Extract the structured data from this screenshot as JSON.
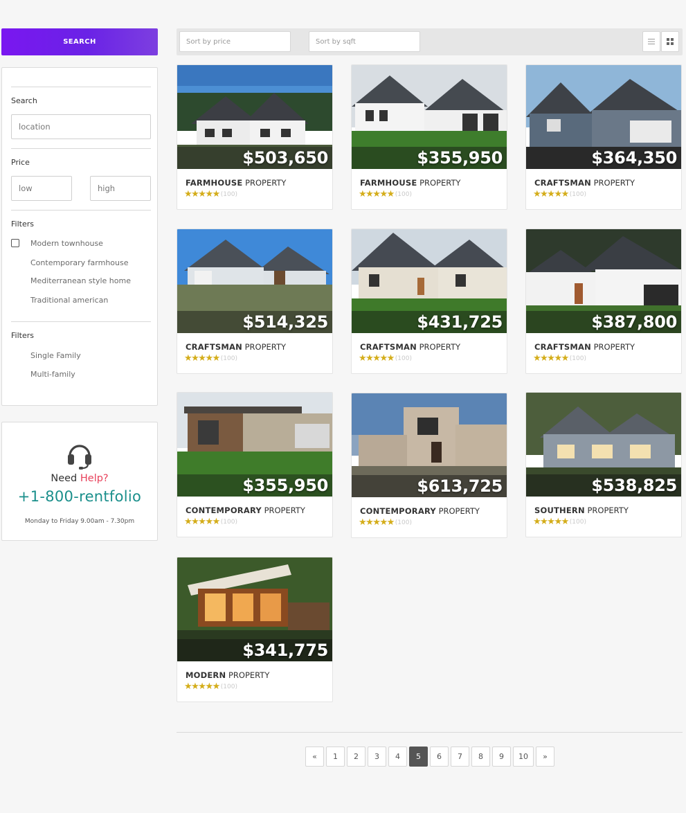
{
  "sidebar": {
    "search_button": "SEARCH",
    "search_label": "Search",
    "location_placeholder": "location",
    "price_label": "Price",
    "low_placeholder": "low",
    "high_placeholder": "high",
    "filters1_label": "Filters",
    "style_options": [
      "Modern townhouse",
      "Contemporary farmhouse",
      "Mediterranean style home",
      "Traditional american"
    ],
    "filters2_label": "Filters",
    "family_options": [
      "Single Family",
      "Multi-family"
    ]
  },
  "help": {
    "icon": "headset-icon",
    "need": "Need",
    "help_word": "Help?",
    "phone": "+1-800-rentfolio",
    "hours": "Monday to Friday 9.00am - 7.30pm"
  },
  "toolbar": {
    "sort_price_placeholder": "Sort by price",
    "sort_sqft_placeholder": "Sort by sqft",
    "list_view_icon": "list-view-icon",
    "grid_view_icon": "grid-view-icon"
  },
  "listings": [
    {
      "price": "$503,650",
      "style": "FARMHOUSE",
      "suffix": "PROPERTY",
      "stars": "★★★★★",
      "reviews": "(100)",
      "rating": 5
    },
    {
      "price": "$355,950",
      "style": "FARMHOUSE",
      "suffix": "PROPERTY",
      "stars": "★★★★★",
      "reviews": "(100)",
      "rating": 5
    },
    {
      "price": "$364,350",
      "style": "CRAFTSMAN",
      "suffix": "PROPERTY",
      "stars": "★★★★★",
      "reviews": "(100)",
      "rating": 5
    },
    {
      "price": "$514,325",
      "style": "CRAFTSMAN",
      "suffix": "PROPERTY",
      "stars": "★★★★★",
      "reviews": "(100)",
      "rating": 5
    },
    {
      "price": "$431,725",
      "style": "CRAFTSMAN",
      "suffix": "PROPERTY",
      "stars": "★★★★★",
      "reviews": "(100)",
      "rating": 5
    },
    {
      "price": "$387,800",
      "style": "CRAFTSMAN",
      "suffix": "PROPERTY",
      "stars": "★★★★★",
      "reviews": "(100)",
      "rating": 5
    },
    {
      "price": "$355,950",
      "style": "CONTEMPORARY",
      "suffix": "PROPERTY",
      "stars": "★★★★★",
      "reviews": "(100)",
      "rating": 5
    },
    {
      "price": "$613,725",
      "style": "CONTEMPORARY",
      "suffix": "PROPERTY",
      "stars": "★★★★★",
      "reviews": "(100)",
      "rating": 5
    },
    {
      "price": "$538,825",
      "style": "SOUTHERN",
      "suffix": "PROPERTY",
      "stars": "★★★★★",
      "reviews": "(100)",
      "rating": 5
    },
    {
      "price": "$341,775",
      "style": "MODERN",
      "suffix": "PROPERTY",
      "stars": "★★★★★",
      "reviews": "(100)",
      "rating": 5
    }
  ],
  "pagination": {
    "prev": "«",
    "pages": [
      "1",
      "2",
      "3",
      "4",
      "5",
      "6",
      "7",
      "8",
      "9",
      "10"
    ],
    "next": "»",
    "current": "5"
  },
  "colors": {
    "search_button": "#7a17f0",
    "help_accent": "#e8405a",
    "phone": "#1a8f8b",
    "star": "#d4ad1a",
    "active_page": "#555555"
  }
}
